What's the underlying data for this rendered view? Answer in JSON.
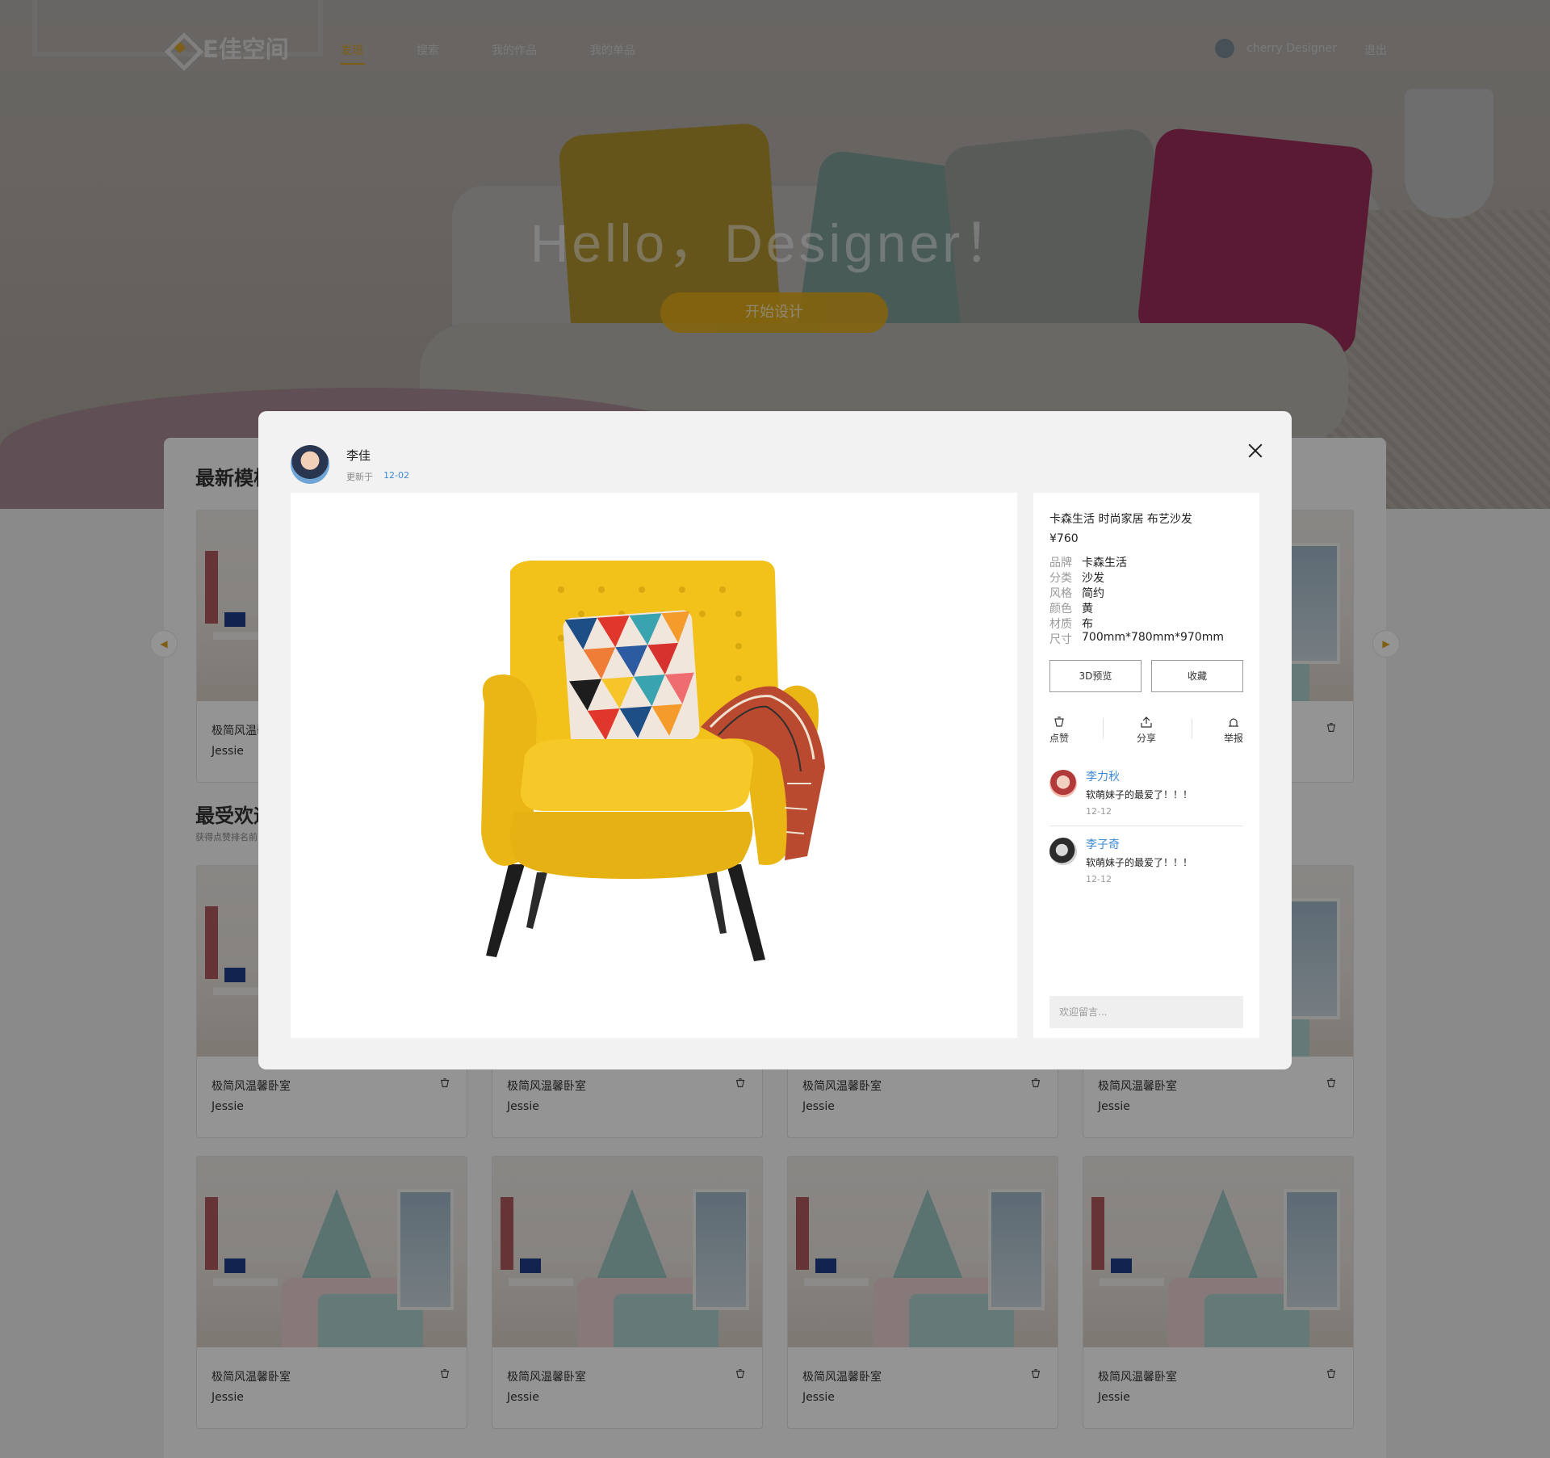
{
  "nav": {
    "logo_text": "E佳空间",
    "items": [
      {
        "label": "发现"
      },
      {
        "label": "搜索"
      },
      {
        "label": "我的作品"
      },
      {
        "label": "我的单品"
      }
    ],
    "user_name": "cherry Designer",
    "exit_label": "退出"
  },
  "hero": {
    "title": "Hello，Designer！",
    "cta": "开始设计"
  },
  "sections": {
    "latest_title": "最新模板",
    "popular_title": "最受欢迎",
    "popular_sub": "获得点赞排名前"
  },
  "card": {
    "name": "极简风温馨卧室",
    "author": "Jessie"
  },
  "modal": {
    "author": "李佳",
    "updated_label": "更新于",
    "updated_date": "12-02",
    "product": {
      "title": "卡森生活 时尚家居 布艺沙发",
      "price": "¥760",
      "specs": [
        {
          "key": "品牌",
          "value": "卡森生活"
        },
        {
          "key": "分类",
          "value": "沙发"
        },
        {
          "key": "风格",
          "value": "简约"
        },
        {
          "key": "颜色",
          "value": "黄"
        },
        {
          "key": "材质",
          "value": "布"
        },
        {
          "key": "尺寸",
          "value": "700mm*780mm*970mm"
        }
      ]
    },
    "buttons": {
      "preview_3d": "3D预览",
      "favorite": "收藏"
    },
    "actions": {
      "like": "点赞",
      "share": "分享",
      "report": "举报"
    },
    "comments": [
      {
        "name": "李力秋",
        "text": "软萌妹子的最爱了！！！",
        "time": "12-12"
      },
      {
        "name": "李子奇",
        "text": "软萌妹子的最爱了！！！",
        "time": "12-12"
      }
    ],
    "comment_placeholder": "欢迎留言..."
  },
  "colors": {
    "accent": "#d7a223",
    "link": "#3d8ad6",
    "chair": "#f2c21b"
  }
}
